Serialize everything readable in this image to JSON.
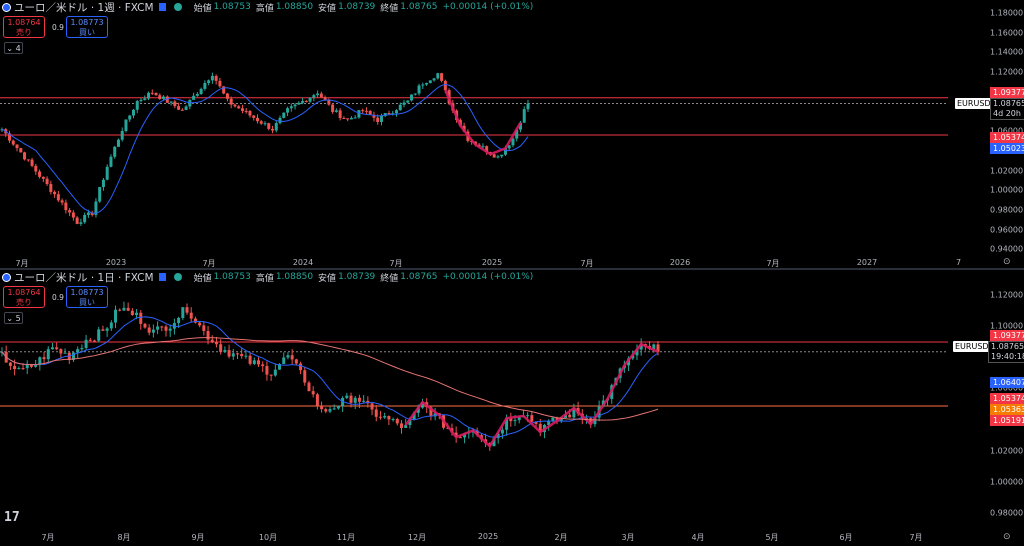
{
  "colors": {
    "up": "#26a69a",
    "down": "#ef5350",
    "ma_fast": "#2962ff",
    "ma_slow": "#e57373",
    "zigzag": "#d81b60",
    "line_top": "#f23645",
    "line_mid": "#d84315",
    "bg": "#000000"
  },
  "panes": [
    {
      "title": "ユーロ／米ドル · 1週 · FXCM",
      "ohlc": {
        "open_label": "始値",
        "open": "1.08753",
        "high_label": "高値",
        "high": "1.08850",
        "low_label": "安値",
        "low": "1.08739",
        "close_label": "終値",
        "close": "1.08765",
        "change": "+0.00014 (+0.01%)"
      },
      "sell": {
        "price": "1.08764",
        "label": "売り"
      },
      "buy": {
        "price": "1.08773",
        "label": "買い"
      },
      "spread": "0.9",
      "indicators_count": "4",
      "y_ticks": [
        "1.18000",
        "1.16000",
        "1.14000",
        "1.12000",
        "1.10000",
        "1.08000",
        "1.06000",
        "1.04000",
        "1.02000",
        "1.00000",
        "0.98000",
        "0.96000",
        "0.94000"
      ],
      "x_ticks": [
        "7月",
        "2023",
        "7月",
        "2024",
        "7月",
        "2025",
        "7月",
        "2026",
        "7月",
        "2027",
        "7月"
      ],
      "symbol": "EURUSD",
      "last_price": "1.08765",
      "countdown": "4d 20h",
      "price_tags": [
        {
          "value": "1.09377",
          "color": "#f23645"
        },
        {
          "value": "1.05374",
          "color": "#f23645"
        },
        {
          "value": "1.05023",
          "color": "#2962ff"
        }
      ]
    },
    {
      "title": "ユーロ／米ドル · 1日 · FXCM",
      "ohlc": {
        "open_label": "始値",
        "open": "1.08753",
        "high_label": "高値",
        "high": "1.08850",
        "low_label": "安値",
        "low": "1.08739",
        "close_label": "終値",
        "close": "1.08765",
        "change": "+0.00014 (+0.01%)"
      },
      "sell": {
        "price": "1.08764",
        "label": "売り"
      },
      "buy": {
        "price": "1.08773",
        "label": "買い"
      },
      "spread": "0.9",
      "indicators_count": "5",
      "y_ticks": [
        "1.12000",
        "1.10000",
        "1.08000",
        "1.06000",
        "1.04000",
        "1.02000",
        "1.00000",
        "0.98000"
      ],
      "x_ticks": [
        "7月",
        "8月",
        "9月",
        "10月",
        "11月",
        "12月",
        "2025",
        "2月",
        "3月",
        "4月",
        "5月",
        "6月",
        "7月"
      ],
      "symbol": "EURUSD",
      "last_price": "1.08765",
      "countdown": "19:40:18",
      "price_tags": [
        {
          "value": "1.09377",
          "color": "#f23645"
        },
        {
          "value": "1.06407",
          "color": "#2962ff"
        },
        {
          "value": "1.05374",
          "color": "#f23645"
        },
        {
          "value": "1.05363",
          "color": "#f57c00"
        },
        {
          "value": "1.05191",
          "color": "#f23645"
        }
      ]
    }
  ],
  "footer": {
    "logo": "17"
  }
}
